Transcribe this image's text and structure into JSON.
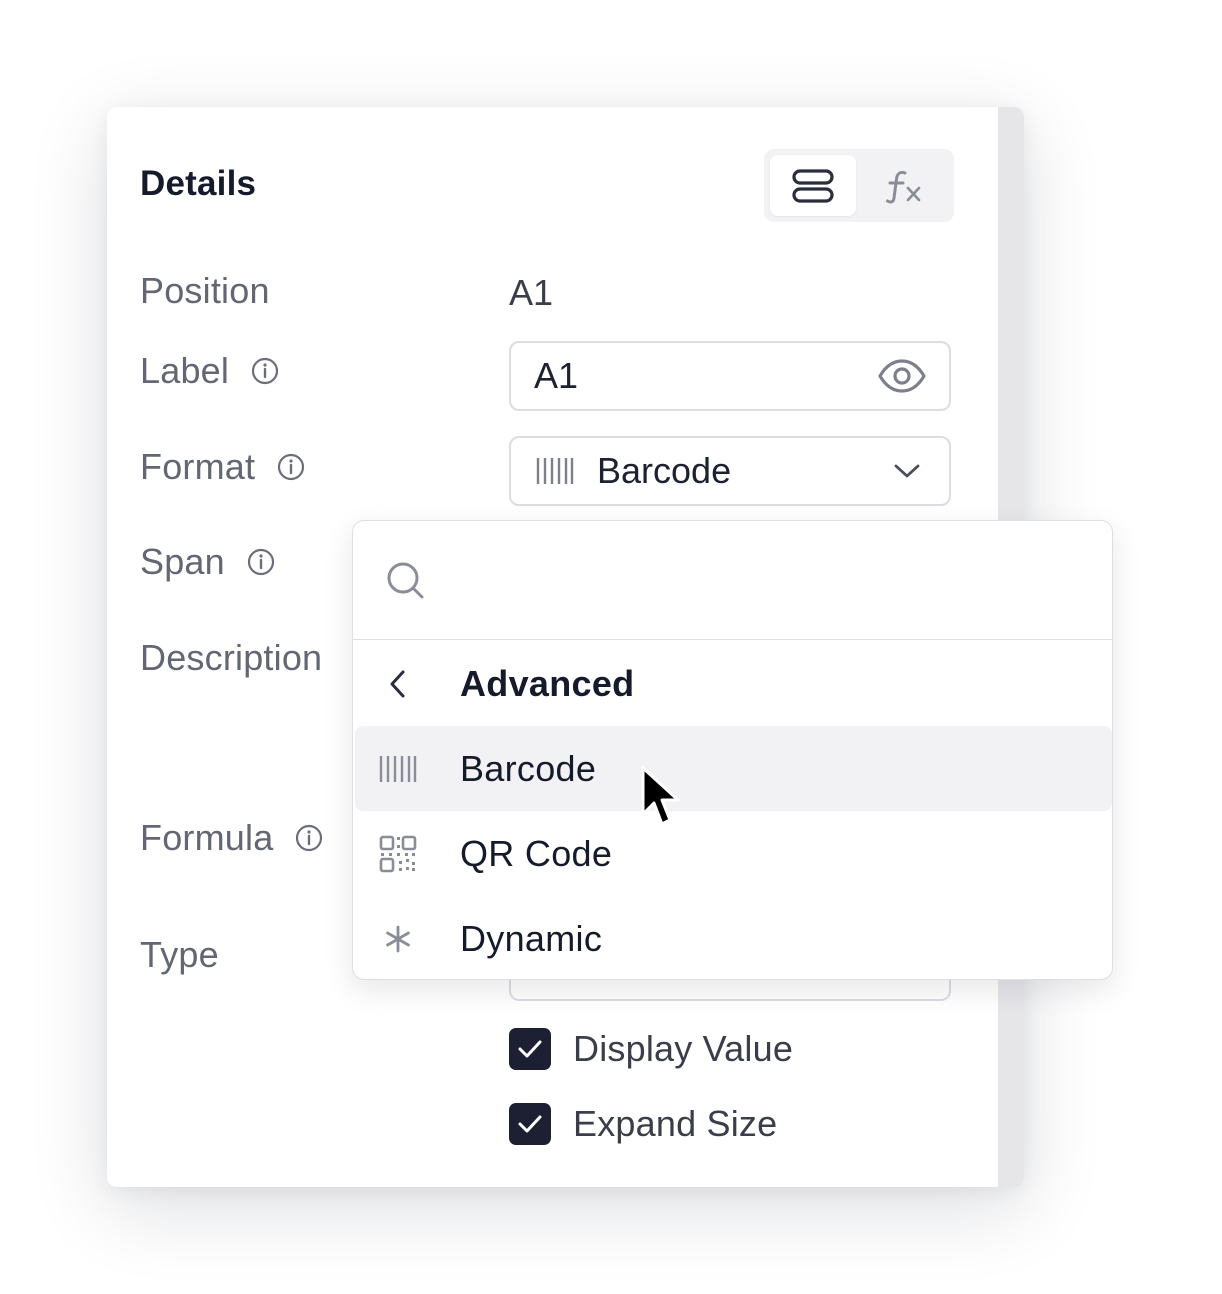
{
  "panel": {
    "title": "Details",
    "toggle": {
      "options": [
        {
          "icon": "rows-icon",
          "active": true
        },
        {
          "icon": "function-icon",
          "active": false
        }
      ]
    },
    "fields": {
      "position": {
        "label": "Position",
        "value": "A1"
      },
      "label": {
        "label": "Label",
        "value": "A1"
      },
      "format": {
        "label": "Format",
        "selected": "Barcode"
      },
      "span": {
        "label": "Span"
      },
      "description": {
        "label": "Description"
      },
      "formula": {
        "label": "Formula"
      },
      "type": {
        "label": "Type"
      }
    },
    "checkboxes": [
      {
        "label": "Display Value",
        "checked": true
      },
      {
        "label": "Expand Size",
        "checked": true
      }
    ]
  },
  "dropdown": {
    "search": {
      "value": "",
      "placeholder": ""
    },
    "back_label": "Advanced",
    "options": [
      {
        "label": "Barcode",
        "icon": "barcode-icon",
        "highlighted": true
      },
      {
        "label": "QR Code",
        "icon": "qr-code-icon",
        "highlighted": false
      },
      {
        "label": "Dynamic",
        "icon": "asterisk-icon",
        "highlighted": false
      }
    ]
  },
  "colors": {
    "title": "#161b2b",
    "label": "#636673",
    "checkbox": "#1c2032",
    "highlight": "#f2f2f4",
    "border": "#dcdde2"
  }
}
